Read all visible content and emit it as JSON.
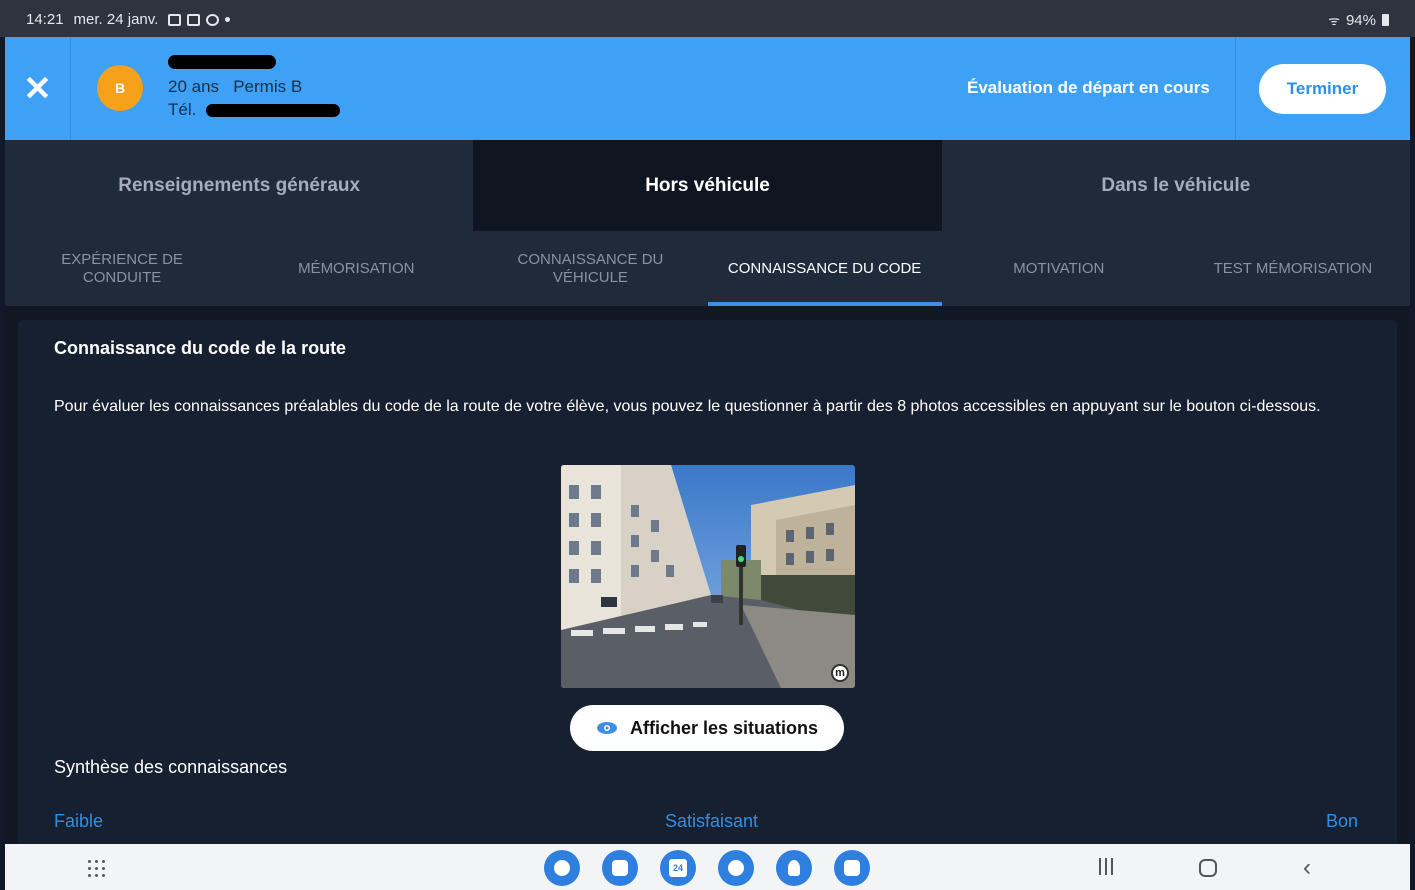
{
  "statusbar": {
    "time": "14:21",
    "date": "mer. 24 janv.",
    "battery": "94%"
  },
  "header": {
    "avatar_initial": "B",
    "student_age": "20 ans",
    "student_license": "Permis B",
    "phone_label": "Tél.",
    "status": "Évaluation de départ en cours",
    "finish_label": "Terminer",
    "colors": {
      "header_bg": "#3ea1f5",
      "avatar": "#f6a11a"
    }
  },
  "main_tabs": [
    {
      "label": "Renseignements généraux",
      "active": false
    },
    {
      "label": "Hors véhicule",
      "active": true
    },
    {
      "label": "Dans le véhicule",
      "active": false
    }
  ],
  "sub_tabs": [
    {
      "label": "EXPÉRIENCE DE CONDUITE",
      "active": false
    },
    {
      "label": "MÉMORISATION",
      "active": false
    },
    {
      "label": "CONNAISSANCE DU VÉHICULE",
      "active": false
    },
    {
      "label": "CONNAISSANCE DU CODE",
      "active": true
    },
    {
      "label": "MOTIVATION",
      "active": false
    },
    {
      "label": "TEST MÉMORISATION",
      "active": false
    }
  ],
  "section": {
    "title": "Connaissance du code de la route",
    "description": "Pour évaluer les connaissances préalables du code de la route de votre élève, vous pouvez le questionner à partir des 8 photos accessibles en appuyant sur le bouton ci-dessous.",
    "show_button_label": "Afficher les situations",
    "synthesis_label": "Synthèse des connaissances",
    "scale": {
      "low": "Faible",
      "mid": "Satisfaisant",
      "high": "Bon"
    }
  },
  "navbar": {
    "calendar_day": "24"
  }
}
